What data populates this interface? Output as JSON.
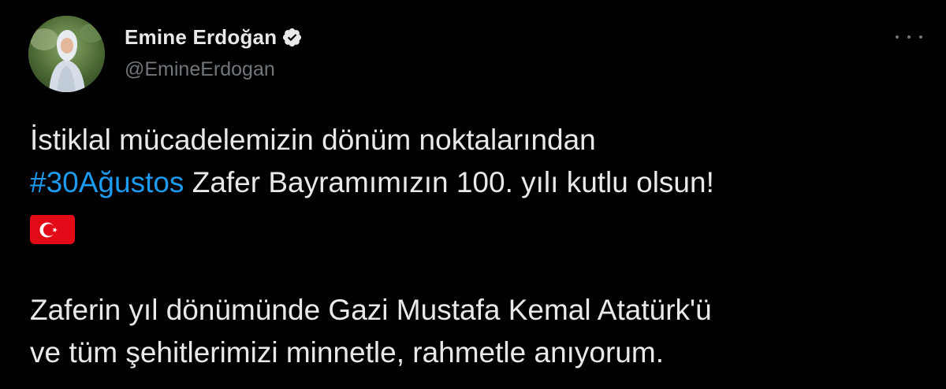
{
  "author": {
    "display_name": "Emine Erdoğan",
    "handle": "@EmineErdogan",
    "verified": true
  },
  "icons": {
    "verified": "verified-badge-icon",
    "more": "more-options-icon",
    "flag": "turkey-flag-emoji"
  },
  "tweet": {
    "line1": "İstiklal mücadelemizin dönüm noktalarından",
    "hashtag": "#30Ağustos",
    "line2_rest": " Zafer Bayramımızın 100. yılı kutlu olsun!",
    "line4": "Zaferin yıl dönümünde Gazi Mustafa Kemal Atatürk'ü",
    "line5": "ve tüm şehitlerimizi minnetle, rahmetle anıyorum."
  },
  "colors": {
    "background": "#000000",
    "text": "#e7e9ea",
    "secondary": "#71767b",
    "link": "#1d9bf0",
    "flag_red": "#e30a17"
  }
}
